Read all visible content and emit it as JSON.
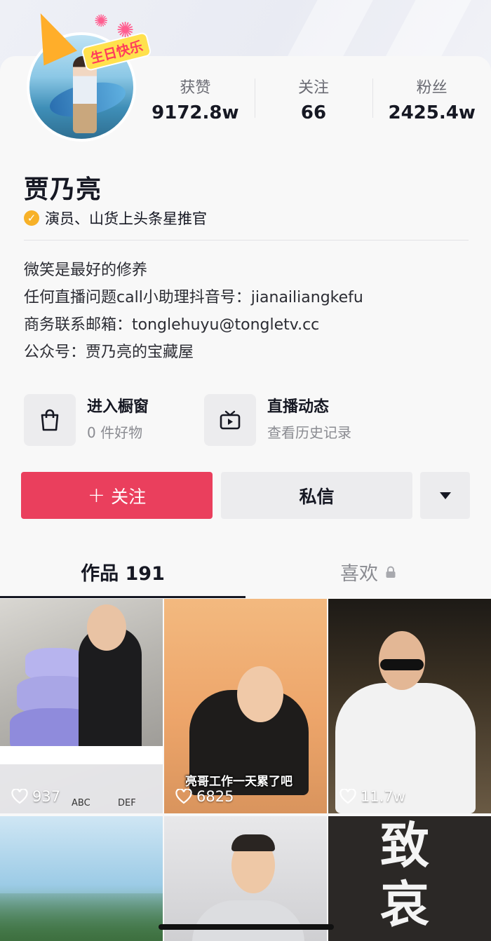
{
  "banner": {
    "birthday_text": "生日快乐"
  },
  "stats": [
    {
      "label": "获赞",
      "value": "9172.8w"
    },
    {
      "label": "关注",
      "value": "66"
    },
    {
      "label": "粉丝",
      "value": "2425.4w"
    }
  ],
  "profile": {
    "name": "贾乃亮",
    "verification": "演员、山货上头条星推官",
    "bio": [
      "微笑是最好的修养",
      "任何直播问题call小助理抖音号：jianailiangkefu",
      "商务联系邮箱：tonglehuyu@tongletv.cc",
      "公众号：贾乃亮的宝藏屋"
    ]
  },
  "entries": {
    "shop": {
      "title": "进入橱窗",
      "subtitle": "0 件好物"
    },
    "live": {
      "title": "直播动态",
      "subtitle": "查看历史记录"
    }
  },
  "actions": {
    "follow": "关注",
    "message": "私信"
  },
  "tabs": {
    "works": "作品 191",
    "likes": "喜欢"
  },
  "videos": [
    {
      "likes": "937"
    },
    {
      "likes": "6825",
      "caption": "亮哥工作一天累了吧"
    },
    {
      "likes": "11.7w"
    },
    {},
    {},
    {
      "title_text": "致哀"
    }
  ],
  "keyboard": {
    "keys": [
      "ABC",
      "DEF"
    ]
  },
  "colors": {
    "follow_button": "#ea3f5d",
    "verify_badge": "#f7b128"
  }
}
